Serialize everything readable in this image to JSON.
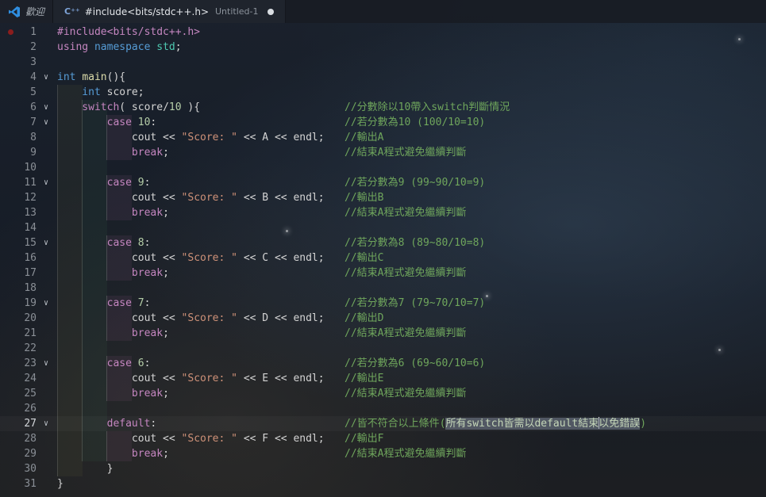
{
  "tabs": [
    {
      "icon": "vscode-logo-icon",
      "label": "歡迎",
      "active": false
    },
    {
      "icon": "cpp-file-icon",
      "icon_text": "C⁺⁺",
      "label": "#include<bits/stdc++.h>",
      "path": "Untitled-1",
      "active": true,
      "dirty": true
    }
  ],
  "lines": [
    {
      "n": "1",
      "parts": [
        {
          "t": "#include<bits/stdc++.h>",
          "c": "inc"
        }
      ],
      "comment": "",
      "breakpoint": true
    },
    {
      "n": "2",
      "parts": [
        {
          "t": "using ",
          "c": "ctl"
        },
        {
          "t": "namespace ",
          "c": "kw"
        },
        {
          "t": "std",
          "c": "ns"
        },
        {
          "t": ";",
          "c": "id"
        }
      ],
      "comment": ""
    },
    {
      "n": "3",
      "parts": [],
      "comment": ""
    },
    {
      "n": "4",
      "fold": true,
      "parts": [
        {
          "t": "int ",
          "c": "kw"
        },
        {
          "t": "main",
          "c": "fn"
        },
        {
          "t": "(){",
          "c": "id"
        }
      ],
      "comment": ""
    },
    {
      "n": "5",
      "parts": [
        {
          "t": "    int ",
          "c": "kw"
        },
        {
          "t": "score;",
          "c": "id"
        }
      ],
      "comment": ""
    },
    {
      "n": "6",
      "fold": true,
      "parts": [
        {
          "t": "    switch",
          "c": "ctl"
        },
        {
          "t": "( score/",
          "c": "id"
        },
        {
          "t": "10",
          "c": "num"
        },
        {
          "t": " ){",
          "c": "id"
        }
      ],
      "comment": "//分數除以10帶入switch判斷情況"
    },
    {
      "n": "7",
      "fold": true,
      "parts": [
        {
          "t": "        case ",
          "c": "ctl"
        },
        {
          "t": "10",
          "c": "num"
        },
        {
          "t": ":",
          "c": "id"
        }
      ],
      "comment": "//若分數為10 (100/10=10)"
    },
    {
      "n": "8",
      "parts": [
        {
          "t": "            cout << ",
          "c": "id"
        },
        {
          "t": "\"Score: \"",
          "c": "str"
        },
        {
          "t": " << A << endl;",
          "c": "id"
        }
      ],
      "comment": "//輸出A"
    },
    {
      "n": "9",
      "parts": [
        {
          "t": "            break",
          "c": "ctl"
        },
        {
          "t": ";",
          "c": "id"
        }
      ],
      "comment": "//結束A程式避免繼續判斷"
    },
    {
      "n": "10",
      "parts": [],
      "comment": ""
    },
    {
      "n": "11",
      "fold": true,
      "parts": [
        {
          "t": "        case ",
          "c": "ctl"
        },
        {
          "t": "9",
          "c": "num"
        },
        {
          "t": ":",
          "c": "id"
        }
      ],
      "comment": "//若分數為9 (99~90/10=9)"
    },
    {
      "n": "12",
      "parts": [
        {
          "t": "            cout << ",
          "c": "id"
        },
        {
          "t": "\"Score: \"",
          "c": "str"
        },
        {
          "t": " << B << endl;",
          "c": "id"
        }
      ],
      "comment": "//輸出B"
    },
    {
      "n": "13",
      "parts": [
        {
          "t": "            break",
          "c": "ctl"
        },
        {
          "t": ";",
          "c": "id"
        }
      ],
      "comment": "//結束A程式避免繼續判斷"
    },
    {
      "n": "14",
      "parts": [],
      "comment": ""
    },
    {
      "n": "15",
      "fold": true,
      "parts": [
        {
          "t": "        case ",
          "c": "ctl"
        },
        {
          "t": "8",
          "c": "num"
        },
        {
          "t": ":",
          "c": "id"
        }
      ],
      "comment": "//若分數為8 (89~80/10=8)"
    },
    {
      "n": "16",
      "parts": [
        {
          "t": "            cout << ",
          "c": "id"
        },
        {
          "t": "\"Score: \"",
          "c": "str"
        },
        {
          "t": " << C << endl;",
          "c": "id"
        }
      ],
      "comment": "//輸出C"
    },
    {
      "n": "17",
      "parts": [
        {
          "t": "            break",
          "c": "ctl"
        },
        {
          "t": ";",
          "c": "id"
        }
      ],
      "comment": "//結束A程式避免繼續判斷"
    },
    {
      "n": "18",
      "parts": [],
      "comment": ""
    },
    {
      "n": "19",
      "fold": true,
      "parts": [
        {
          "t": "        case ",
          "c": "ctl"
        },
        {
          "t": "7",
          "c": "num"
        },
        {
          "t": ":",
          "c": "id"
        }
      ],
      "comment": "//若分數為7 (79~70/10=7)"
    },
    {
      "n": "20",
      "parts": [
        {
          "t": "            cout << ",
          "c": "id"
        },
        {
          "t": "\"Score: \"",
          "c": "str"
        },
        {
          "t": " << D << endl;",
          "c": "id"
        }
      ],
      "comment": "//輸出D"
    },
    {
      "n": "21",
      "parts": [
        {
          "t": "            break",
          "c": "ctl"
        },
        {
          "t": ";",
          "c": "id"
        }
      ],
      "comment": "//結束A程式避免繼續判斷"
    },
    {
      "n": "22",
      "parts": [],
      "comment": ""
    },
    {
      "n": "23",
      "fold": true,
      "parts": [
        {
          "t": "        case ",
          "c": "ctl"
        },
        {
          "t": "6",
          "c": "num"
        },
        {
          "t": ":",
          "c": "id"
        }
      ],
      "comment": "//若分數為6 (69~60/10=6)"
    },
    {
      "n": "24",
      "parts": [
        {
          "t": "            cout << ",
          "c": "id"
        },
        {
          "t": "\"Score: \"",
          "c": "str"
        },
        {
          "t": " << E << endl;",
          "c": "id"
        }
      ],
      "comment": "//輸出E"
    },
    {
      "n": "25",
      "parts": [
        {
          "t": "            break",
          "c": "ctl"
        },
        {
          "t": ";",
          "c": "id"
        }
      ],
      "comment": "//結束A程式避免繼續判斷"
    },
    {
      "n": "26",
      "parts": [],
      "comment": ""
    },
    {
      "n": "27",
      "fold": true,
      "current": true,
      "parts": [
        {
          "t": "        default",
          "c": "ctl"
        },
        {
          "t": ":",
          "c": "id"
        }
      ],
      "comment_parts": [
        {
          "t": "//皆不符合以上條件(",
          "c": ""
        },
        {
          "t": "所有switch皆需以default結束",
          "c": "sel"
        },
        {
          "t": "|",
          "c": "caret"
        },
        {
          "t": "以免錯誤",
          "c": "sel"
        },
        {
          "t": ")",
          "c": ""
        }
      ]
    },
    {
      "n": "28",
      "parts": [
        {
          "t": "            cout << ",
          "c": "id"
        },
        {
          "t": "\"Score: \"",
          "c": "str"
        },
        {
          "t": " << F << endl;",
          "c": "id"
        }
      ],
      "comment": "//輸出F"
    },
    {
      "n": "29",
      "parts": [
        {
          "t": "            break",
          "c": "ctl"
        },
        {
          "t": ";",
          "c": "id"
        }
      ],
      "comment": "//結束A程式避免繼續判斷"
    },
    {
      "n": "30",
      "parts": [
        {
          "t": "        }",
          "c": "id"
        }
      ],
      "comment": ""
    },
    {
      "n": "31",
      "parts": [
        {
          "t": "}",
          "c": "id"
        }
      ],
      "comment": ""
    }
  ],
  "colors": {
    "keyword": "#569cd6",
    "control": "#c586c0",
    "number": "#b5cea8",
    "string": "#ce9178",
    "comment": "#6fa65c",
    "namespace": "#4ec9b0",
    "function": "#dcdcaa"
  }
}
